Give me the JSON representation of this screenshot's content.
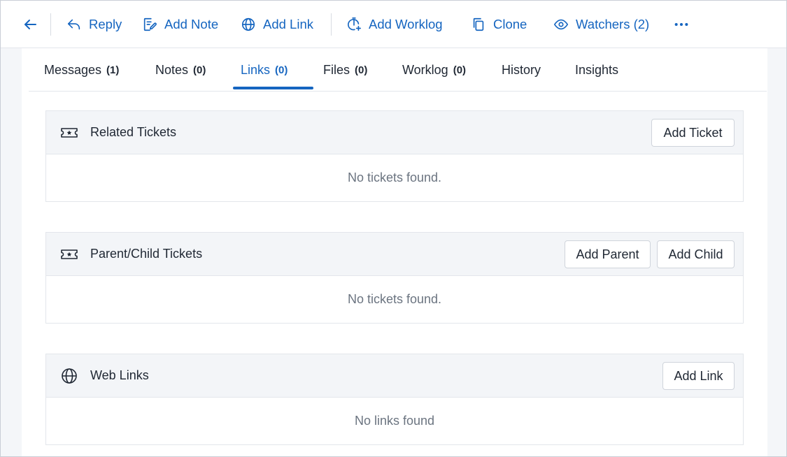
{
  "toolbar": {
    "back_icon": "arrow-left-icon",
    "reply": "Reply",
    "add_note": "Add Note",
    "add_link": "Add Link",
    "add_worklog": "Add Worklog",
    "clone": "Clone",
    "watchers": "Watchers (2)",
    "more_icon": "more-horizontal-icon",
    "accent": "#1565c0"
  },
  "tabs": [
    {
      "label": "Messages",
      "count": "(1)"
    },
    {
      "label": "Notes",
      "count": "(0)"
    },
    {
      "label": "Links",
      "count": "(0)",
      "active": true
    },
    {
      "label": "Files",
      "count": "(0)"
    },
    {
      "label": "Worklog",
      "count": "(0)"
    },
    {
      "label": "History"
    },
    {
      "label": "Insights"
    }
  ],
  "sections": {
    "related": {
      "icon": "ticket-icon",
      "title": "Related Tickets",
      "add_ticket": "Add Ticket",
      "empty": "No tickets found."
    },
    "parent_child": {
      "icon": "ticket-icon",
      "title": "Parent/Child Tickets",
      "add_parent": "Add Parent",
      "add_child": "Add Child",
      "empty": "No tickets found."
    },
    "web_links": {
      "icon": "globe-icon",
      "title": "Web Links",
      "add_link": "Add Link",
      "empty": "No links found"
    }
  }
}
